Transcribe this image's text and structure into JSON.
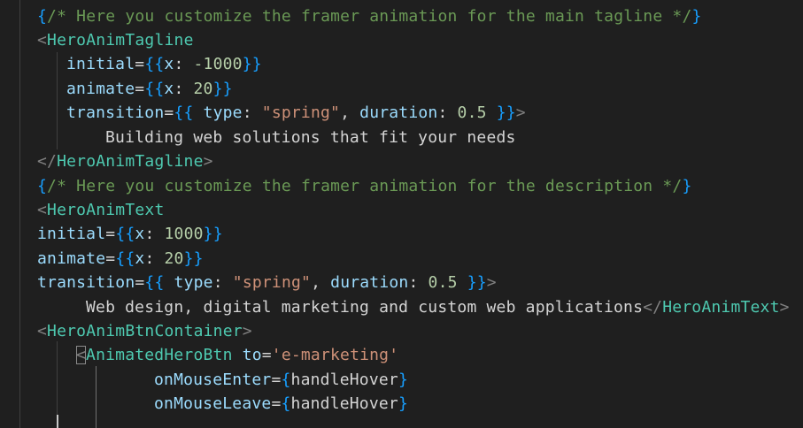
{
  "editor": {
    "lines": [
      {
        "segments": [
          {
            "text": "{",
            "cls": "br3",
            "name": "jsx-brace"
          },
          {
            "text": "/* Here you customize the framer animation for the main tagline */",
            "cls": "cm",
            "name": "code-comment"
          },
          {
            "text": "}",
            "cls": "br3",
            "name": "jsx-brace"
          }
        ]
      },
      {
        "segments": [
          {
            "text": "<",
            "cls": "punc",
            "name": "tag-bracket"
          },
          {
            "text": "HeroAnimTagline",
            "cls": "tag",
            "name": "component-tag"
          }
        ]
      },
      {
        "segments": [
          {
            "text": "initial",
            "cls": "attr",
            "name": "prop-name"
          },
          {
            "text": "=",
            "cls": "op",
            "name": "operator"
          },
          {
            "text": "{{",
            "cls": "br3",
            "name": "jsx-brace"
          },
          {
            "text": "x",
            "cls": "attr",
            "name": "object-key"
          },
          {
            "text": ": ",
            "cls": "op",
            "name": "operator"
          },
          {
            "text": "-1000",
            "cls": "num",
            "name": "numeric-value"
          },
          {
            "text": "}}",
            "cls": "br3",
            "name": "jsx-brace"
          }
        ]
      },
      {
        "segments": [
          {
            "text": "animate",
            "cls": "attr",
            "name": "prop-name"
          },
          {
            "text": "=",
            "cls": "op",
            "name": "operator"
          },
          {
            "text": "{{",
            "cls": "br3",
            "name": "jsx-brace"
          },
          {
            "text": "x",
            "cls": "attr",
            "name": "object-key"
          },
          {
            "text": ": ",
            "cls": "op",
            "name": "operator"
          },
          {
            "text": "20",
            "cls": "num",
            "name": "numeric-value"
          },
          {
            "text": "}}",
            "cls": "br3",
            "name": "jsx-brace"
          }
        ]
      },
      {
        "segments": [
          {
            "text": "transition",
            "cls": "attr",
            "name": "prop-name"
          },
          {
            "text": "=",
            "cls": "op",
            "name": "operator"
          },
          {
            "text": "{{",
            "cls": "br3",
            "name": "jsx-brace"
          },
          {
            "text": " ",
            "cls": "op",
            "name": "whitespace"
          },
          {
            "text": "type",
            "cls": "attr",
            "name": "object-key"
          },
          {
            "text": ": ",
            "cls": "op",
            "name": "operator"
          },
          {
            "text": "\"spring\"",
            "cls": "str",
            "name": "string-value"
          },
          {
            "text": ", ",
            "cls": "op",
            "name": "operator"
          },
          {
            "text": "duration",
            "cls": "attr",
            "name": "object-key"
          },
          {
            "text": ": ",
            "cls": "op",
            "name": "operator"
          },
          {
            "text": "0.5",
            "cls": "num",
            "name": "numeric-value"
          },
          {
            "text": " ",
            "cls": "op",
            "name": "whitespace"
          },
          {
            "text": "}}",
            "cls": "br3",
            "name": "jsx-brace"
          },
          {
            "text": ">",
            "cls": "punc",
            "name": "tag-bracket"
          }
        ]
      },
      {
        "segments": [
          {
            "text": "Building web solutions that fit your needs",
            "cls": "txt",
            "name": "jsx-text"
          }
        ]
      },
      {
        "segments": [
          {
            "text": "</",
            "cls": "punc",
            "name": "tag-bracket"
          },
          {
            "text": "HeroAnimTagline",
            "cls": "tag",
            "name": "component-tag"
          },
          {
            "text": ">",
            "cls": "punc",
            "name": "tag-bracket"
          }
        ]
      },
      {
        "segments": [
          {
            "text": "{",
            "cls": "br3",
            "name": "jsx-brace"
          },
          {
            "text": "/* Here you customize the framer animation for the description */",
            "cls": "cm",
            "name": "code-comment"
          },
          {
            "text": "}",
            "cls": "br3",
            "name": "jsx-brace"
          }
        ]
      },
      {
        "segments": [
          {
            "text": "<",
            "cls": "punc",
            "name": "tag-bracket"
          },
          {
            "text": "HeroAnimText",
            "cls": "tag",
            "name": "component-tag"
          }
        ]
      },
      {
        "segments": [
          {
            "text": "initial",
            "cls": "attr",
            "name": "prop-name"
          },
          {
            "text": "=",
            "cls": "op",
            "name": "operator"
          },
          {
            "text": "{{",
            "cls": "br3",
            "name": "jsx-brace"
          },
          {
            "text": "x",
            "cls": "attr",
            "name": "object-key"
          },
          {
            "text": ": ",
            "cls": "op",
            "name": "operator"
          },
          {
            "text": "1000",
            "cls": "num",
            "name": "numeric-value"
          },
          {
            "text": "}}",
            "cls": "br3",
            "name": "jsx-brace"
          }
        ]
      },
      {
        "segments": [
          {
            "text": "animate",
            "cls": "attr",
            "name": "prop-name"
          },
          {
            "text": "=",
            "cls": "op",
            "name": "operator"
          },
          {
            "text": "{{",
            "cls": "br3",
            "name": "jsx-brace"
          },
          {
            "text": "x",
            "cls": "attr",
            "name": "object-key"
          },
          {
            "text": ": ",
            "cls": "op",
            "name": "operator"
          },
          {
            "text": "20",
            "cls": "num",
            "name": "numeric-value"
          },
          {
            "text": "}}",
            "cls": "br3",
            "name": "jsx-brace"
          }
        ]
      },
      {
        "segments": [
          {
            "text": "transition",
            "cls": "attr",
            "name": "prop-name"
          },
          {
            "text": "=",
            "cls": "op",
            "name": "operator"
          },
          {
            "text": "{{",
            "cls": "br3",
            "name": "jsx-brace"
          },
          {
            "text": " ",
            "cls": "op",
            "name": "whitespace"
          },
          {
            "text": "type",
            "cls": "attr",
            "name": "object-key"
          },
          {
            "text": ": ",
            "cls": "op",
            "name": "operator"
          },
          {
            "text": "\"spring\"",
            "cls": "str",
            "name": "string-value"
          },
          {
            "text": ", ",
            "cls": "op",
            "name": "operator"
          },
          {
            "text": "duration",
            "cls": "attr",
            "name": "object-key"
          },
          {
            "text": ": ",
            "cls": "op",
            "name": "operator"
          },
          {
            "text": "0.5",
            "cls": "num",
            "name": "numeric-value"
          },
          {
            "text": " ",
            "cls": "op",
            "name": "whitespace"
          },
          {
            "text": "}}",
            "cls": "br3",
            "name": "jsx-brace"
          },
          {
            "text": ">",
            "cls": "punc",
            "name": "tag-bracket"
          }
        ]
      },
      {
        "segments": [
          {
            "text": "Web design, digital marketing and custom web applications",
            "cls": "txt",
            "name": "jsx-text"
          },
          {
            "text": "</",
            "cls": "punc",
            "name": "tag-bracket"
          },
          {
            "text": "HeroAnimText",
            "cls": "tag",
            "name": "component-tag"
          },
          {
            "text": ">",
            "cls": "punc",
            "name": "tag-bracket"
          }
        ]
      },
      {
        "segments": [
          {
            "text": "<",
            "cls": "punc",
            "name": "tag-bracket"
          },
          {
            "text": "HeroAnimBtnContainer",
            "cls": "tag",
            "name": "component-tag"
          },
          {
            "text": ">",
            "cls": "punc",
            "name": "tag-bracket"
          }
        ]
      },
      {
        "segments": [
          {
            "text": "<",
            "cls": "punc",
            "name": "tag-bracket-matched",
            "box": true
          },
          {
            "text": "AnimatedHeroBtn",
            "cls": "tag",
            "name": "component-tag"
          },
          {
            "text": " ",
            "cls": "op",
            "name": "whitespace"
          },
          {
            "text": "to",
            "cls": "attr",
            "name": "prop-name"
          },
          {
            "text": "=",
            "cls": "op",
            "name": "operator"
          },
          {
            "text": "'e-marketing'",
            "cls": "str",
            "name": "string-value"
          }
        ]
      },
      {
        "segments": [
          {
            "text": "onMouseEnter",
            "cls": "attr",
            "name": "prop-name"
          },
          {
            "text": "=",
            "cls": "op",
            "name": "operator"
          },
          {
            "text": "{",
            "cls": "br3",
            "name": "jsx-brace"
          },
          {
            "text": "handleHover",
            "cls": "txt",
            "name": "identifier"
          },
          {
            "text": "}",
            "cls": "br3",
            "name": "jsx-brace"
          }
        ]
      },
      {
        "segments": [
          {
            "text": "onMouseLeave",
            "cls": "attr",
            "name": "prop-name"
          },
          {
            "text": "=",
            "cls": "op",
            "name": "operator"
          },
          {
            "text": "{",
            "cls": "br3",
            "name": "jsx-brace"
          },
          {
            "text": "handleHover",
            "cls": "txt",
            "name": "identifier"
          },
          {
            "text": "}",
            "cls": "br3",
            "name": "jsx-brace"
          }
        ]
      }
    ]
  }
}
